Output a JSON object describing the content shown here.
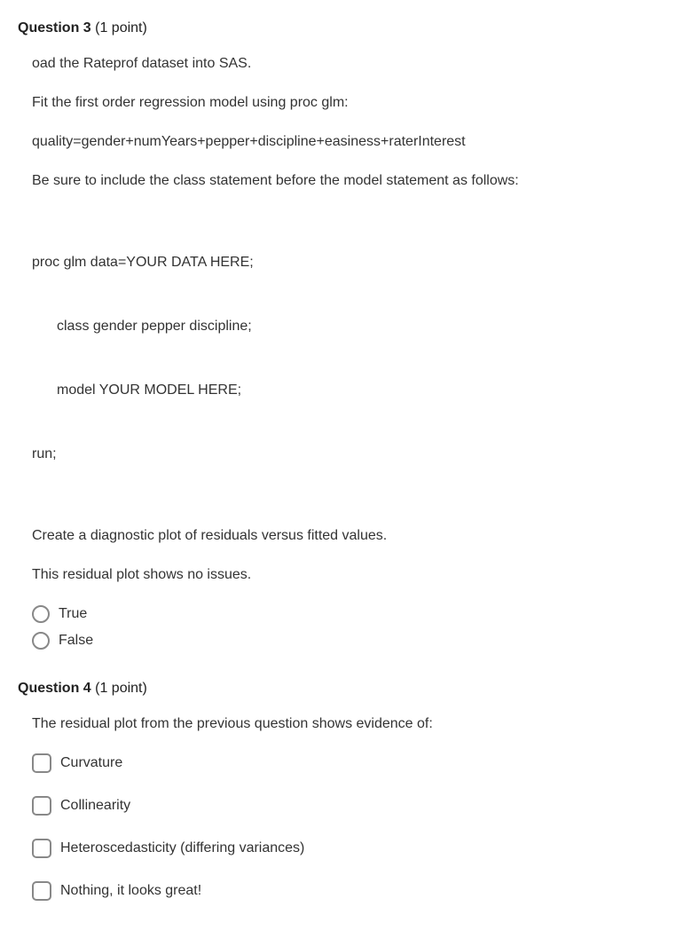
{
  "q3": {
    "header_number": "Question 3",
    "header_points": " (1 point)",
    "p1": "oad the Rateprof dataset into SAS.",
    "p2": "Fit the first order regression model using proc glm:",
    "p3": "quality=gender+numYears+pepper+discipline+easiness+raterInterest",
    "p4": "Be sure to include the class statement before the model statement as follows:",
    "code1": "proc glm data=YOUR DATA HERE;",
    "code2": "class gender pepper discipline;",
    "code3": "model YOUR MODEL HERE;",
    "code4": "run;",
    "p5": "Create a diagnostic plot of residuals versus fitted values.",
    "p6": "This residual plot shows no issues.",
    "options": {
      "true": "True",
      "false": "False"
    }
  },
  "q4": {
    "header_number": "Question 4",
    "header_points": " (1 point)",
    "p1": "The residual plot from the previous question shows evidence of:",
    "options": {
      "curvature": "Curvature",
      "collinearity": "Collinearity",
      "heteroscedasticity": "Heteroscedasticity (differing variances)",
      "nothing": "Nothing, it looks great!"
    }
  }
}
